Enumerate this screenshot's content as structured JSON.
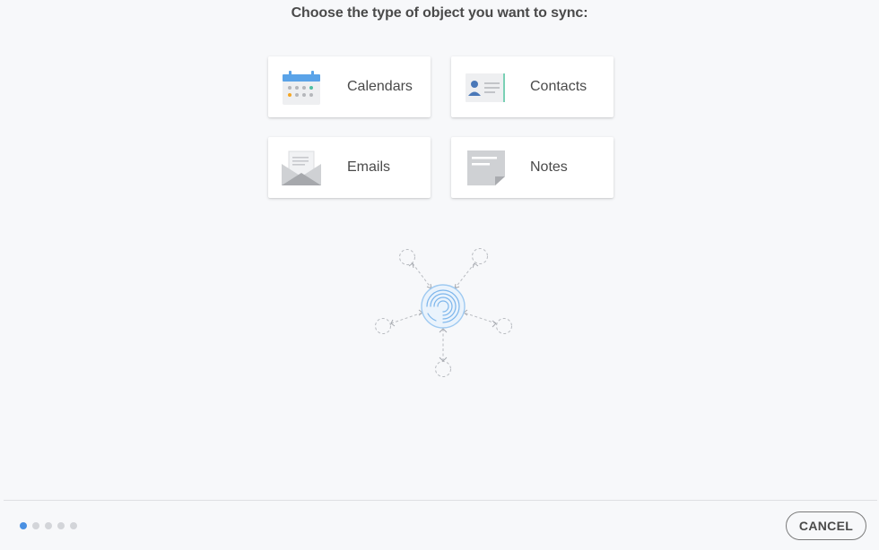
{
  "heading": "Choose the type of object you want to sync:",
  "options": [
    {
      "label": "Calendars",
      "icon": "calendar-icon"
    },
    {
      "label": "Contacts",
      "icon": "contact-card-icon"
    },
    {
      "label": "Emails",
      "icon": "envelope-icon"
    },
    {
      "label": "Notes",
      "icon": "note-icon"
    }
  ],
  "illustration_icon": "sync-hub-icon",
  "progress": {
    "total_steps": 5,
    "current_step": 1
  },
  "footer": {
    "cancel_label": "CANCEL"
  },
  "colors": {
    "accent": "#4a90e2",
    "background": "#f7f8fa",
    "text": "#4a4a4a"
  }
}
